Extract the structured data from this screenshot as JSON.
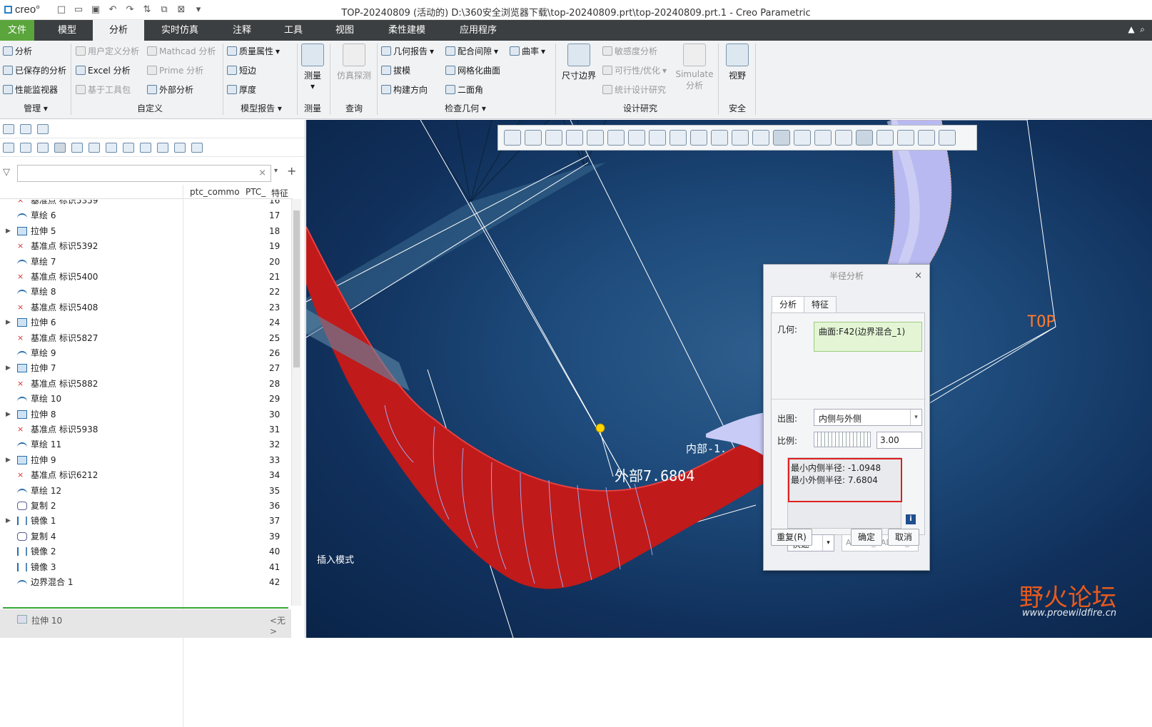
{
  "app": {
    "logo": "creo°",
    "title": "TOP-20240809 (活动的) D:\\360安全浏览器下载\\top-20240809.prt\\top-20240809.prt.1 - Creo Parametric"
  },
  "menu": {
    "tabs": [
      "文件",
      "模型",
      "分析",
      "实时仿真",
      "注释",
      "工具",
      "视图",
      "柔性建模",
      "应用程序"
    ],
    "active": "分析"
  },
  "ribbon": {
    "manage": {
      "items": [
        "分析",
        "已保存的分析",
        "性能监视器"
      ],
      "label": "管理"
    },
    "custom": {
      "items": [
        "用户定义分析",
        "Excel 分析",
        "基于工具包",
        "Mathcad 分析",
        "Prime 分析",
        "外部分析"
      ],
      "label": "自定义"
    },
    "model_report": {
      "items": [
        "质量属性",
        "短边",
        "厚度"
      ],
      "label": "模型报告"
    },
    "measure": {
      "button": "测量",
      "label": "测量"
    },
    "query": {
      "button": "仿真探测",
      "label": "查询"
    },
    "inspect": {
      "items": [
        "几何报告",
        "拔模",
        "构建方向",
        "配合间隙",
        "网格化曲面",
        "二面角",
        "曲率"
      ],
      "label": "检查几何"
    },
    "design": {
      "dim": "尺寸边界",
      "items": [
        "敏感度分析",
        "可行性/优化",
        "统计设计研究"
      ],
      "sim": "Simulate 分析",
      "label": "设计研究"
    },
    "safety": {
      "button": "视野",
      "label": "安全"
    }
  },
  "tree": {
    "filter_placeholder": "",
    "columns": [
      "ptc_commo",
      "PTC_",
      "特征"
    ],
    "rows": [
      {
        "name": "基准点 标识5359",
        "num": "16",
        "type": "pt"
      },
      {
        "name": "草绘 6",
        "num": "17",
        "type": "sk"
      },
      {
        "name": "拉伸 5",
        "num": "18",
        "type": "ex"
      },
      {
        "name": "基准点 标识5392",
        "num": "19",
        "type": "pt"
      },
      {
        "name": "草绘 7",
        "num": "20",
        "type": "sk"
      },
      {
        "name": "基准点 标识5400",
        "num": "21",
        "type": "pt"
      },
      {
        "name": "草绘 8",
        "num": "22",
        "type": "sk"
      },
      {
        "name": "基准点 标识5408",
        "num": "23",
        "type": "pt"
      },
      {
        "name": "拉伸 6",
        "num": "24",
        "type": "ex"
      },
      {
        "name": "基准点 标识5827",
        "num": "25",
        "type": "pt"
      },
      {
        "name": "草绘 9",
        "num": "26",
        "type": "sk"
      },
      {
        "name": "拉伸 7",
        "num": "27",
        "type": "ex"
      },
      {
        "name": "基准点 标识5882",
        "num": "28",
        "type": "pt"
      },
      {
        "name": "草绘 10",
        "num": "29",
        "type": "sk"
      },
      {
        "name": "拉伸 8",
        "num": "30",
        "type": "ex"
      },
      {
        "name": "基准点 标识5938",
        "num": "31",
        "type": "pt"
      },
      {
        "name": "草绘 11",
        "num": "32",
        "type": "sk"
      },
      {
        "name": "拉伸 9",
        "num": "33",
        "type": "ex"
      },
      {
        "name": "基准点 标识6212",
        "num": "34",
        "type": "pt"
      },
      {
        "name": "草绘 12",
        "num": "35",
        "type": "sk"
      },
      {
        "name": "复制 2",
        "num": "36",
        "type": "cp"
      },
      {
        "name": "镜像 1",
        "num": "37",
        "type": "mi"
      },
      {
        "name": "复制 4",
        "num": "39",
        "type": "cp"
      },
      {
        "name": "镜像 2",
        "num": "40",
        "type": "mi"
      },
      {
        "name": "镜像 3",
        "num": "41",
        "type": "mi"
      },
      {
        "name": "边界混合 1",
        "num": "42",
        "type": "sk"
      }
    ],
    "last": {
      "name": "拉伸 10",
      "value": "<无>"
    }
  },
  "viewport": {
    "insert_mode": "插入模式",
    "plane_label": "TOP",
    "inner_label": "内部-1.",
    "outer_label": "外部7.6804"
  },
  "dialog": {
    "title": "半径分析",
    "tabs": [
      "分析",
      "特征"
    ],
    "geometry_label": "几何:",
    "geometry_value": "曲面:F42(边界混合_1)",
    "plot_label": "出图:",
    "plot_value": "内侧与外侧",
    "ratio_label": "比例:",
    "ratio_value": "3.00",
    "result_inner": "最小内侧半径: -1.0948",
    "result_outer": "最小外侧半径: 7.6804",
    "mode": "快速",
    "name_value": "ALYSIS_RADIUS_1",
    "repeat": "重复(R)",
    "ok": "确定",
    "cancel": "取消"
  },
  "watermark": {
    "text": "野火论坛",
    "url": "www.proewildfire.cn"
  }
}
